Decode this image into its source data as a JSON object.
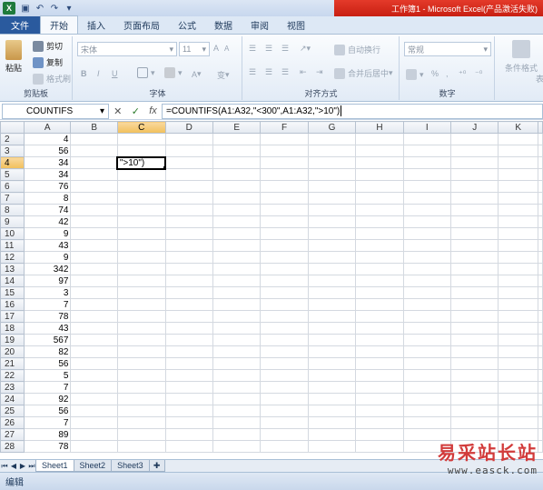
{
  "window": {
    "title": "工作簿1 - Microsoft Excel(产品激活失败)",
    "app_icon": "X"
  },
  "quick_access": [
    "save-icon",
    "undo-icon",
    "redo-icon",
    "customize-icon"
  ],
  "ribbon_tabs": [
    "文件",
    "开始",
    "插入",
    "页面布局",
    "公式",
    "数据",
    "审阅",
    "视图"
  ],
  "ribbon": {
    "clipboard": {
      "paste": "粘贴",
      "cut": "剪切",
      "copy": "复制",
      "format_painter": "格式刷",
      "label": "剪贴板"
    },
    "font": {
      "font_name": "宋体",
      "font_size": "11",
      "bold": "B",
      "italic": "I",
      "underline": "U",
      "grow": "A",
      "shrink": "A",
      "font_color": "A",
      "phonetic": "变",
      "label": "字体"
    },
    "alignment": {
      "wrap": "自动换行",
      "merge": "合并后居中",
      "label": "对齐方式"
    },
    "number": {
      "format": "常规",
      "percent": "%",
      "comma": ",",
      "label": "数字"
    },
    "styles": {
      "conditional": "条件格式",
      "more": "表"
    }
  },
  "formula_bar": {
    "name_box": "COUNTIFS",
    "cancel": "✕",
    "enter": "✓",
    "fx": "fx",
    "formula": "=COUNTIFS(A1:A32,\"<300\",A1:A32,\">10\")"
  },
  "columns": [
    "A",
    "B",
    "C",
    "D",
    "E",
    "F",
    "G",
    "H",
    "I",
    "J",
    "K"
  ],
  "selected_column": "C",
  "selected_row": 4,
  "rows": [
    {
      "row": 2,
      "a": "4"
    },
    {
      "row": 3,
      "a": "56"
    },
    {
      "row": 4,
      "a": "34",
      "c": "\">10\")"
    },
    {
      "row": 5,
      "a": "34"
    },
    {
      "row": 6,
      "a": "76"
    },
    {
      "row": 7,
      "a": "8"
    },
    {
      "row": 8,
      "a": "74"
    },
    {
      "row": 9,
      "a": "42"
    },
    {
      "row": 10,
      "a": "9"
    },
    {
      "row": 11,
      "a": "43"
    },
    {
      "row": 12,
      "a": "9"
    },
    {
      "row": 13,
      "a": "342"
    },
    {
      "row": 14,
      "a": "97"
    },
    {
      "row": 15,
      "a": "3"
    },
    {
      "row": 16,
      "a": "7"
    },
    {
      "row": 17,
      "a": "78"
    },
    {
      "row": 18,
      "a": "43"
    },
    {
      "row": 19,
      "a": "567"
    },
    {
      "row": 20,
      "a": "82"
    },
    {
      "row": 21,
      "a": "56"
    },
    {
      "row": 22,
      "a": "5"
    },
    {
      "row": 23,
      "a": "7"
    },
    {
      "row": 24,
      "a": "92"
    },
    {
      "row": 25,
      "a": "56"
    },
    {
      "row": 26,
      "a": "7"
    },
    {
      "row": 27,
      "a": "89"
    },
    {
      "row": 28,
      "a": "78"
    }
  ],
  "sheet_tabs": [
    "Sheet1",
    "Sheet2",
    "Sheet3"
  ],
  "active_sheet": "Sheet1",
  "status": "编辑",
  "watermark": {
    "text": "易采站长站",
    "url": "www.easck.com"
  },
  "colors": {
    "title_red": "#d42a1c",
    "file_tab": "#2a5a9e",
    "selection_header": "#f1c05a"
  }
}
